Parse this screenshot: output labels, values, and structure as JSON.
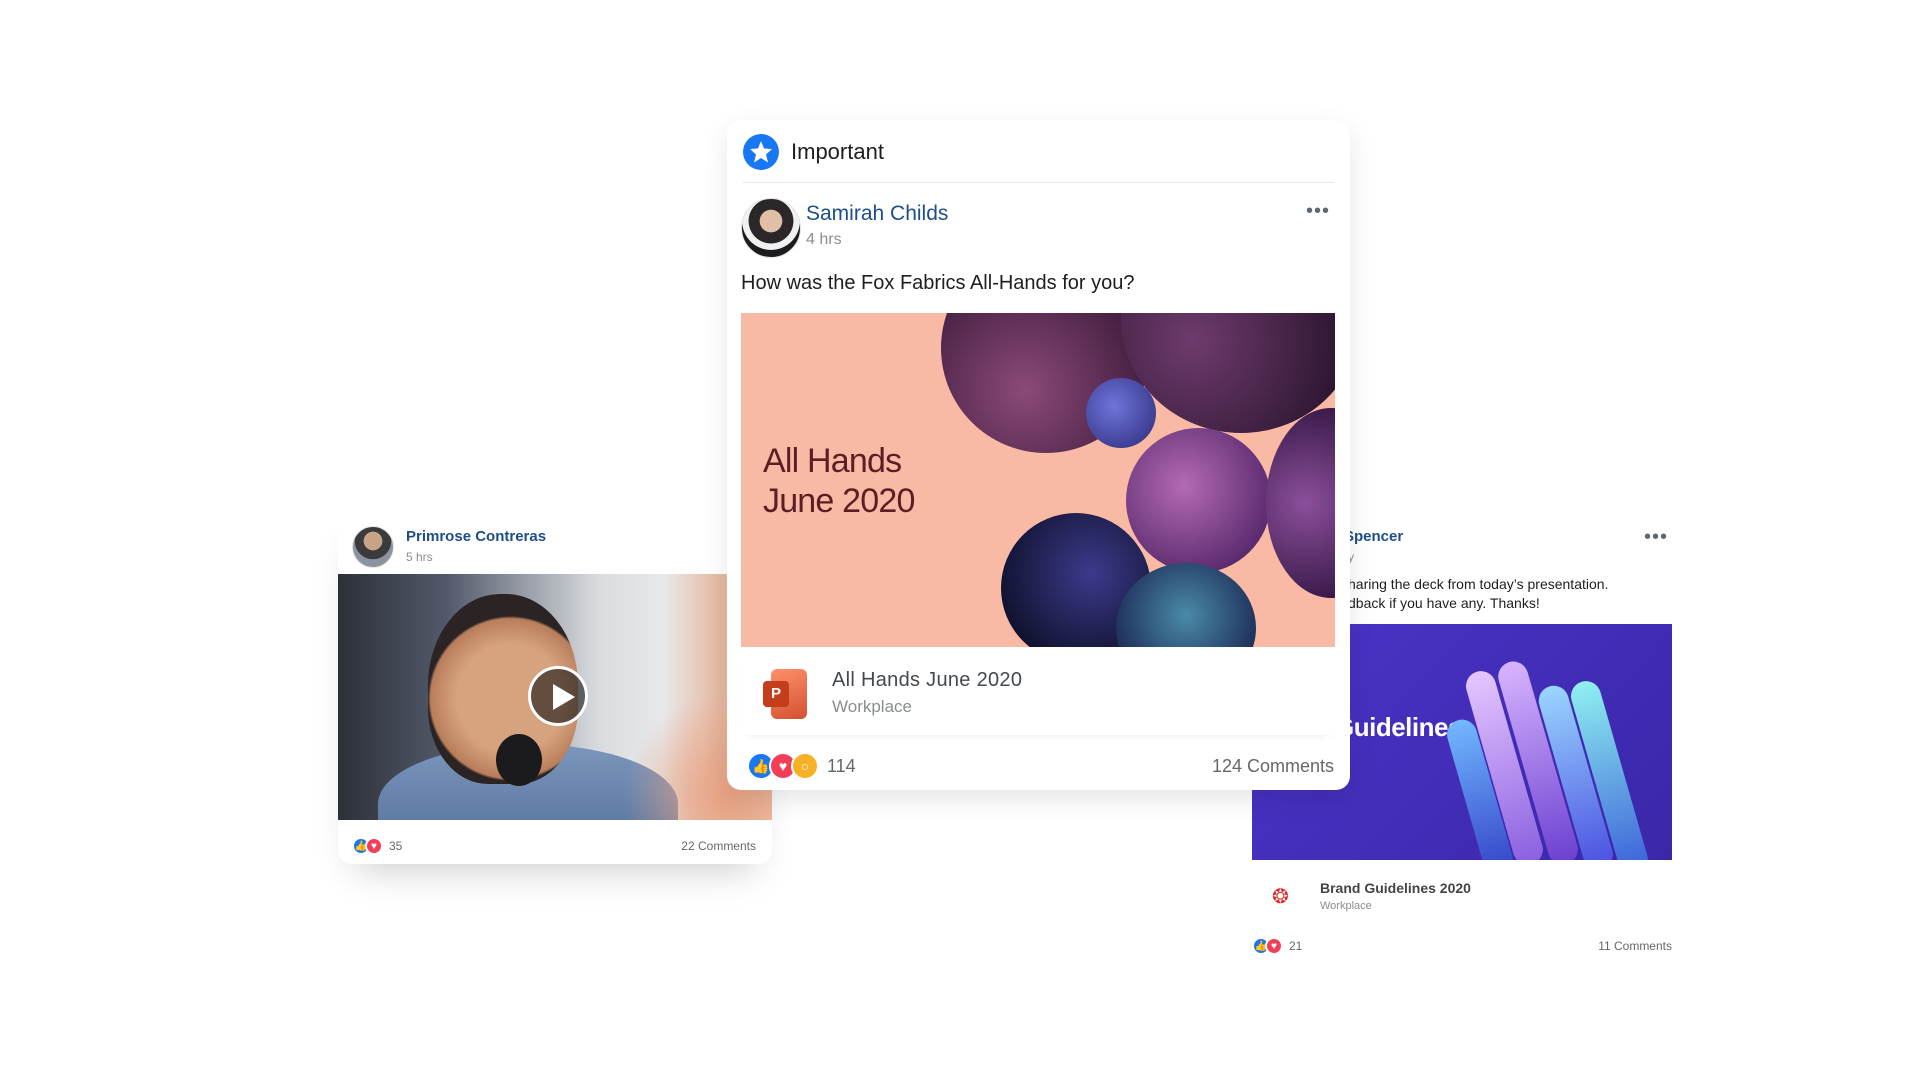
{
  "center_post": {
    "section_label": "Important",
    "author": "Samirah Childs",
    "time": "4 hrs",
    "text": "How was the Fox Fabrics All-Hands for you?",
    "slide_title": "All Hands\nJune 2020",
    "attachment": {
      "file_name": "All Hands June 2020",
      "source": "Workplace",
      "icon": "powerpoint-icon"
    },
    "reactions": {
      "count": "114",
      "types": [
        "like",
        "love",
        "wow"
      ]
    },
    "comments": "124 Comments",
    "more_icon": "•••"
  },
  "left_post": {
    "author": "Primrose Contreras",
    "time": "5 hrs",
    "reactions": {
      "count": "35",
      "types": [
        "like",
        "love"
      ]
    },
    "comments": "22 Comments"
  },
  "right_post": {
    "author_partial": "Spencer",
    "time_partial": "y",
    "text_line1": "haring the deck from today’s presentation.",
    "text_line2": "dback if you have any. Thanks!",
    "slide_title": "Guidelines",
    "attachment": {
      "file_name": "Brand Guidelines 2020",
      "source": "Workplace",
      "icon": "acrobat-icon"
    },
    "reactions": {
      "count": "21",
      "types": [
        "like",
        "love"
      ]
    },
    "comments": "11 Comments",
    "more_icon": "•••"
  },
  "colors": {
    "brand_blue": "#1877f2",
    "name_blue": "#1d4e89",
    "slide_peach": "#f8b9a5",
    "slide_purple": "#4a34c9"
  }
}
